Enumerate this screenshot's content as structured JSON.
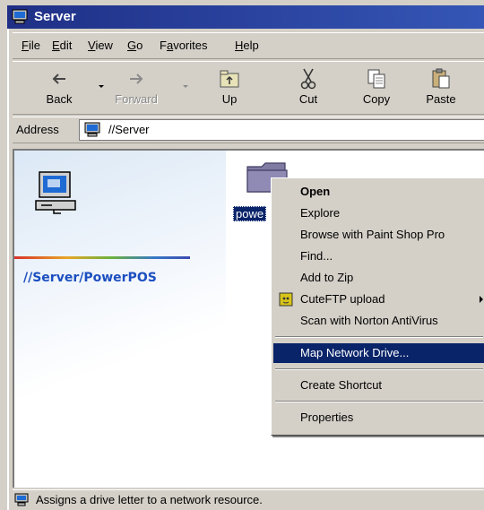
{
  "window": {
    "title": "Server"
  },
  "menubar": {
    "items": [
      {
        "label": "File",
        "accel": "F",
        "rest": "ile"
      },
      {
        "label": "Edit",
        "accel": "E",
        "rest": "dit"
      },
      {
        "label": "View",
        "accel": "V",
        "rest": "iew"
      },
      {
        "label": "Go",
        "accel": "G",
        "rest": "o"
      },
      {
        "label": "Favorites",
        "pre": "F",
        "accel": "a",
        "rest": "vorites"
      },
      {
        "label": "Help",
        "accel": "H",
        "rest": "elp"
      }
    ]
  },
  "toolbar": {
    "back_label": "Back",
    "forward_label": "Forward",
    "up_label": "Up",
    "cut_label": "Cut",
    "copy_label": "Copy",
    "paste_label": "Paste"
  },
  "address": {
    "label": "Address",
    "value": "//Server"
  },
  "left_pane": {
    "path_text": "//Server/PowerPOS"
  },
  "folder": {
    "label": "powe"
  },
  "context_menu": {
    "items": [
      {
        "label": "Open",
        "bold": true
      },
      {
        "label": "Explore"
      },
      {
        "label": "Browse with Paint Shop Pro"
      },
      {
        "label": "Find..."
      },
      {
        "label": "Add to Zip"
      },
      {
        "label": "CuteFTP upload",
        "icon": "cuteftp-icon",
        "submenu": true
      },
      {
        "label": "Scan with Norton AntiVirus"
      },
      {
        "label": "Map Network Drive...",
        "highlighted": true
      },
      {
        "label": "Create Shortcut"
      },
      {
        "label": "Properties"
      }
    ]
  },
  "statusbar": {
    "text": "Assigns a drive letter to a network resource."
  },
  "colors": {
    "titlebar": "#1f2f86",
    "highlight": "#0a246a",
    "path_text": "#1c4fc0",
    "chrome": "#d4d0c8"
  }
}
